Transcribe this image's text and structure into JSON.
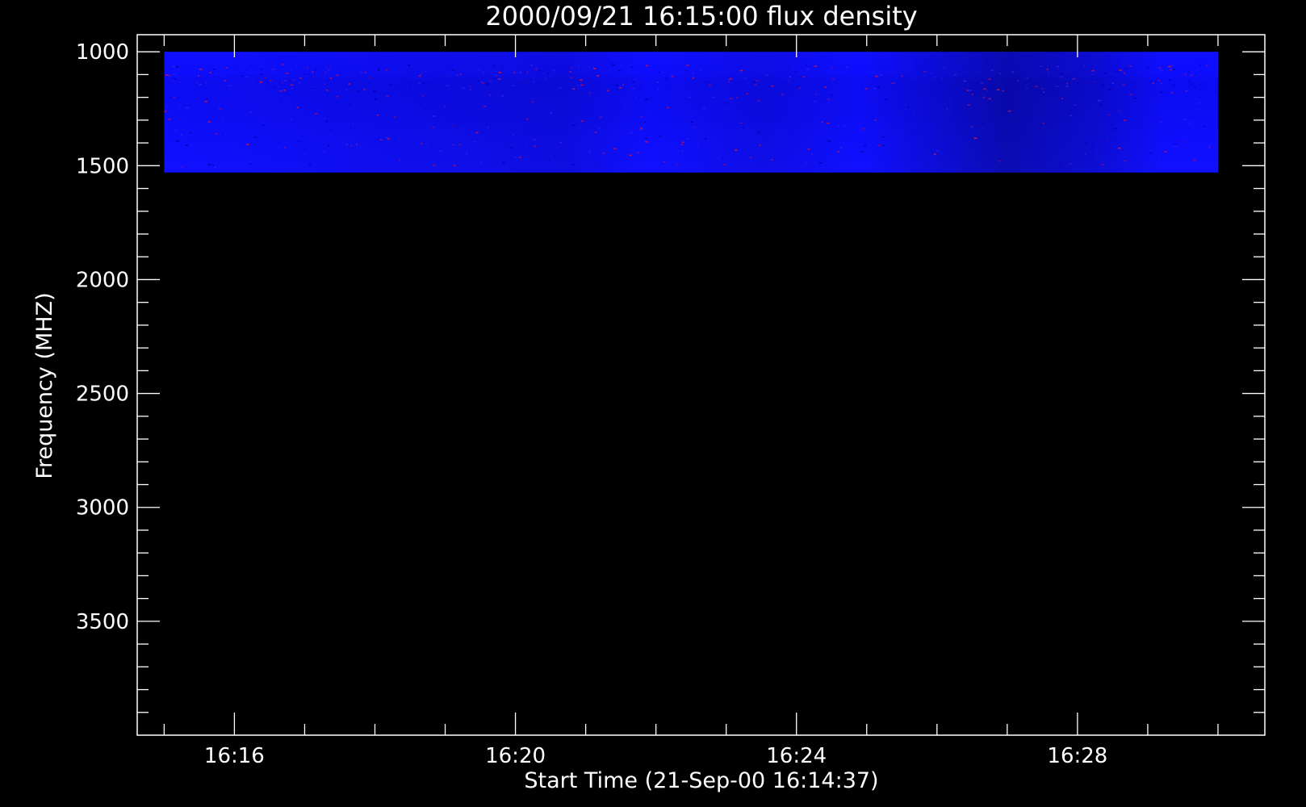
{
  "chart_data": {
    "type": "heatmap",
    "title": "2000/09/21 16:15:00 flux density",
    "xlabel": "Start Time (21-Sep-00 16:14:37)",
    "ylabel": "Frequency (MHZ)",
    "x_start": "16:14:37",
    "x_end": "16:30:40",
    "xlim": [
      "16:14:37",
      "16:30:40"
    ],
    "xticks": [
      "16:16",
      "16:20",
      "16:24",
      "16:28"
    ],
    "x_minor_ticks": [
      "16:15",
      "16:16",
      "16:17",
      "16:18",
      "16:19",
      "16:20",
      "16:21",
      "16:22",
      "16:23",
      "16:24",
      "16:25",
      "16:26",
      "16:27",
      "16:28",
      "16:29",
      "16:30"
    ],
    "ylim": [
      4000,
      925
    ],
    "yticks": [
      1000,
      1500,
      2000,
      2500,
      3000,
      3500
    ],
    "y_minor_step": 100,
    "data_region": {
      "time_start": "16:15:00",
      "time_end": "16:30:00",
      "freq_min": 1000,
      "freq_max": 1530
    },
    "colors": {
      "background": "#000000",
      "foreground": "#ffffff",
      "data_base": "#1010ff",
      "noise": "#cc1040"
    }
  }
}
